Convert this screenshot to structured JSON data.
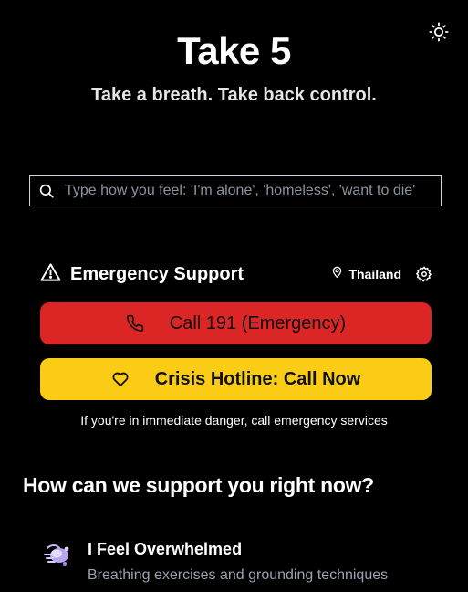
{
  "app": {
    "title": "Take 5",
    "subtitle": "Take a breath. Take back control.",
    "theme_toggle_icon": "sun-icon"
  },
  "search": {
    "placeholder": "Type how you feel: 'I'm alone', 'homeless', 'want to die'",
    "value": ""
  },
  "emergency": {
    "title": "Emergency Support",
    "location": "Thailand",
    "emergency_button_label": "Call 191 (Emergency)",
    "crisis_button_label": "Crisis Hotline: Call Now",
    "note": "If you're in immediate danger, call emergency services",
    "colors": {
      "emergency": "#dc2626",
      "crisis": "#facc15"
    }
  },
  "support": {
    "heading": "How can we support you right now?",
    "options": [
      {
        "title": "I Feel Overwhelmed",
        "description": "Breathing exercises and grounding techniques",
        "icon": "wind-icon"
      }
    ]
  }
}
